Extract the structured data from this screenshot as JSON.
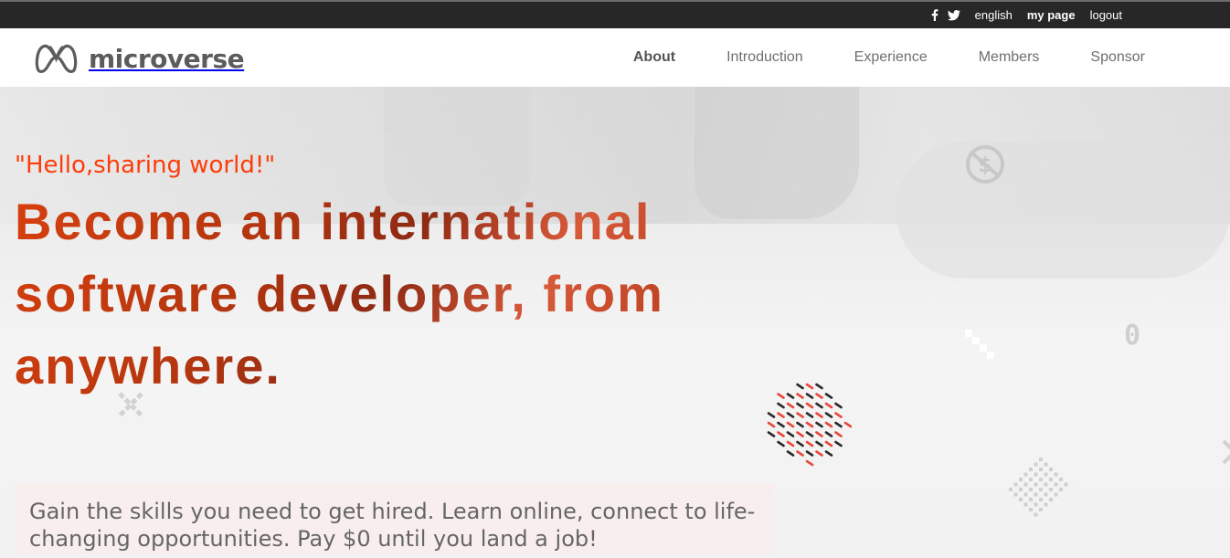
{
  "topbar": {
    "social": [
      {
        "icon": "facebook-icon"
      },
      {
        "icon": "twitter-icon"
      }
    ],
    "language": "english",
    "mypage": "my page",
    "logout": "logout"
  },
  "header": {
    "logo_text": "microverse",
    "nav": [
      {
        "label": "About",
        "active": true
      },
      {
        "label": "Introduction",
        "active": false
      },
      {
        "label": "Experience",
        "active": false
      },
      {
        "label": "Members",
        "active": false
      },
      {
        "label": "Sponsor",
        "active": false
      }
    ]
  },
  "hero": {
    "greeting": "\"Hello,sharing world!\"",
    "headline": "Become an international software developer, from anywhere.",
    "subtitle": "Gain the skills you need to get hired. Learn online, connect to life-changing opportunities. Pay $0 until you land a job!",
    "decor": {
      "zero_glyph": "0"
    }
  },
  "colors": {
    "topbar_bg": "#272727",
    "accent": "#ff3d0a",
    "headline": "#b4360f",
    "nav_text": "#6f6f6f"
  }
}
